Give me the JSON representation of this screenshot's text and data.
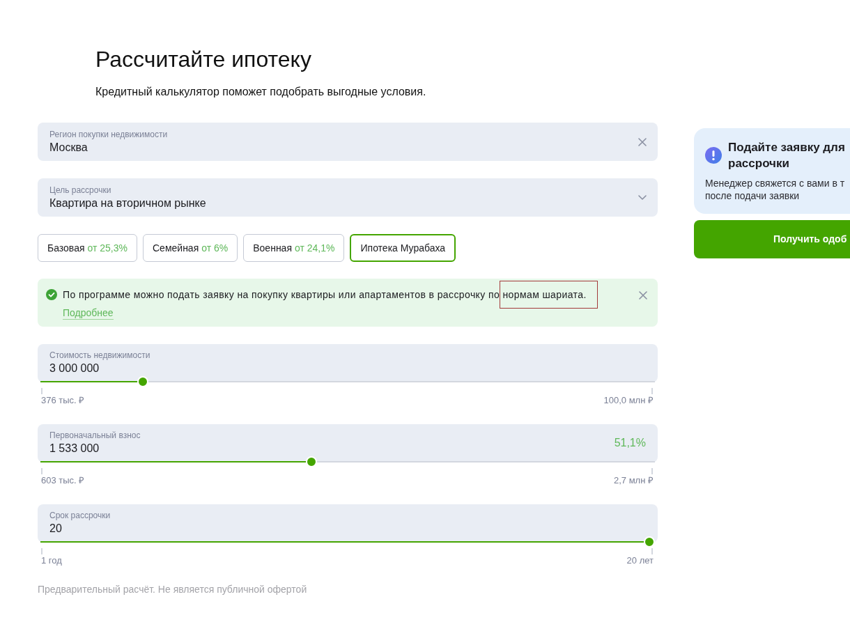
{
  "heading": {
    "title": "Рассчитайте ипотеку",
    "subtitle": "Кредитный калькулятор поможет подобрать выгодные условия."
  },
  "fields": [
    {
      "kind": "clearable",
      "label": "Регион покупки недвижимости",
      "value": "Москва"
    },
    {
      "kind": "select",
      "label": "Цель рассрочки",
      "value": "Квартира на вторичном рынке"
    }
  ],
  "programs": [
    {
      "name": "Базовая",
      "rate": "от 25,3%",
      "selected": false
    },
    {
      "name": "Семейная",
      "rate": "от 6%",
      "selected": false
    },
    {
      "name": "Военная",
      "rate": "от 24,1%",
      "selected": false
    },
    {
      "name": "Ипотека Мурабаха",
      "selected": true
    }
  ],
  "notice": {
    "text": "По программе можно подать заявку на покупку квартиры или апартаментов в рассрочку по нормам шариата.",
    "link": "Подробнее"
  },
  "sliders": [
    {
      "label": "Стоимость недвижимости",
      "value": "3 000 000",
      "level": 0.16,
      "min_label": "376 тыс. ₽",
      "max_label": "100,0 млн ₽"
    },
    {
      "label": "Первоначальный взнос",
      "value": "1 533 000",
      "share": "51,1%",
      "level": 0.44,
      "min_label": "603 тыс. ₽",
      "max_label": "2,7 млн ₽"
    },
    {
      "label": "Срок рассрочки",
      "value": "20",
      "level": 1,
      "min_label": "1 год",
      "max_label": "20 лет"
    }
  ],
  "disclaimer": "Предварительный расчёт. Не является публичной офертой",
  "application": {
    "title_lines": [
      "Подайте заявку для",
      "рассрочки"
    ],
    "description_lines": [
      "Менеджер свяжется с вами в т",
      "после подачи заявки"
    ],
    "button": "Получить одоб"
  }
}
